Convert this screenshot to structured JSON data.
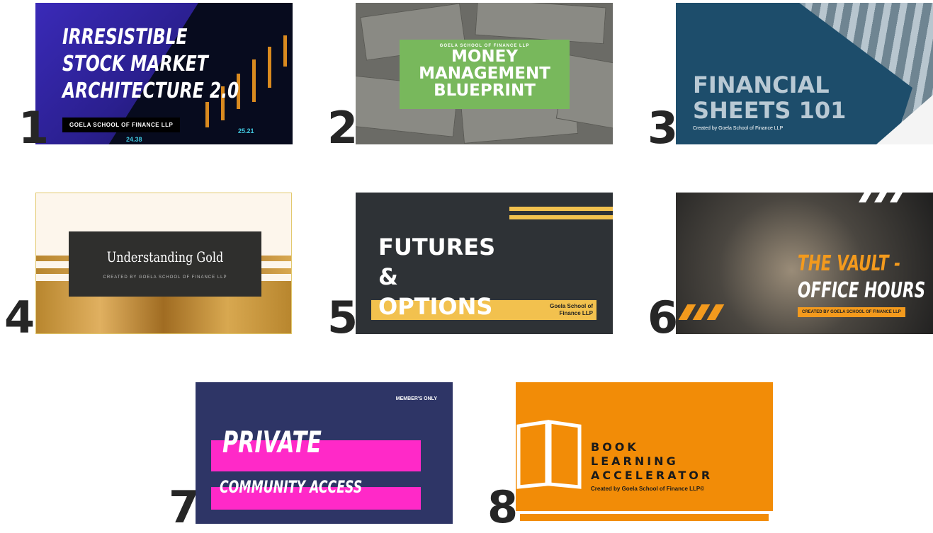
{
  "cards": [
    {
      "number": "1",
      "title_lines": [
        "IRRESISTIBLE",
        "STOCK MARKET",
        "ARCHITECTURE 2.0"
      ],
      "subtitle": "GOELA SCHOOL OF FINANCE LLP",
      "ticks": [
        "25.21",
        "24.38"
      ]
    },
    {
      "number": "2",
      "pre_title": "GOELA SCHOOL OF FINANCE LLP",
      "title_lines": [
        "MONEY",
        "MANAGEMENT",
        "BLUEPRINT"
      ]
    },
    {
      "number": "3",
      "title_lines": [
        "FINANCIAL",
        "SHEETS 101"
      ],
      "subtitle": "Created by Goela School of Finance LLP"
    },
    {
      "number": "4",
      "title": "Understanding Gold",
      "subtitle": "CREATED BY GOELA SCHOOL OF FINANCE LLP"
    },
    {
      "number": "5",
      "title_lines": [
        "FUTURES",
        "&",
        "OPTIONS"
      ],
      "subtitle_lines": [
        "Goela School of",
        "Finance LLP"
      ]
    },
    {
      "number": "6",
      "title_lines": [
        "THE VAULT -",
        "OFFICE HOURS"
      ],
      "subtitle": "CREATED BY GOELA SCHOOL OF FINANCE LLP"
    },
    {
      "number": "7",
      "badge": "MEMBER'S ONLY",
      "title": "PRIVATE",
      "title2": "COMMUNITY ACCESS"
    },
    {
      "number": "8",
      "title_lines": [
        "BOOK",
        "LEARNING",
        "ACCELERATOR"
      ],
      "subtitle": "Created by Goela School of Finance LLP©"
    }
  ],
  "colors": {
    "orange": "#f28c07",
    "pink": "#ff29c8",
    "green": "#78b85c",
    "yellow": "#f2c14e"
  }
}
